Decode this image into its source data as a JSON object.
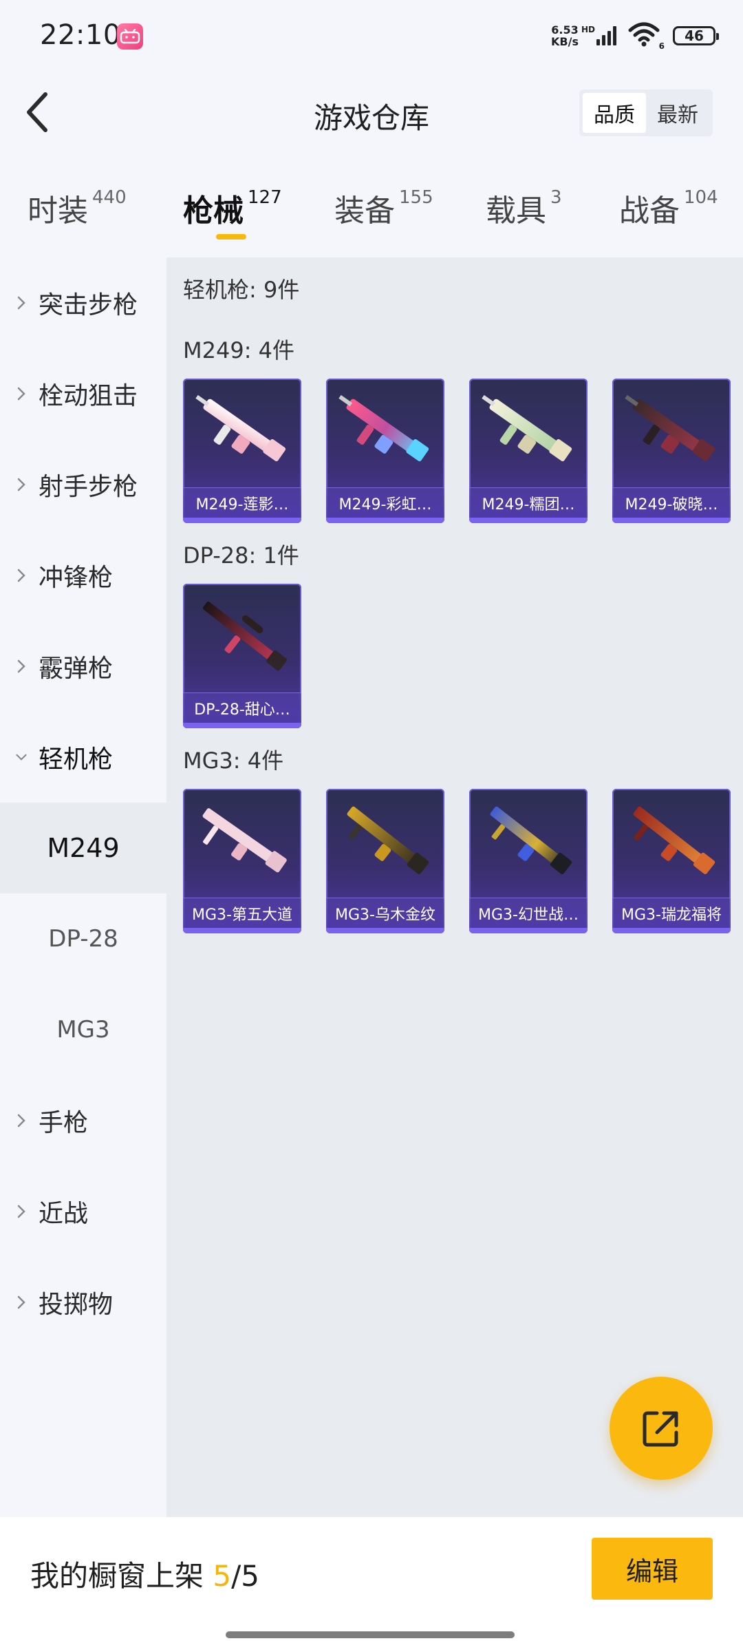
{
  "status_bar": {
    "time": "22:10",
    "net_speed_value": "6.53",
    "net_speed_unit": "KB/s",
    "hd_label": "HD",
    "wifi_label": "6",
    "battery": "46",
    "app_badge": "bilibili"
  },
  "header": {
    "title": "游戏仓库",
    "sort_options": [
      "品质",
      "最新"
    ],
    "sort_active": "品质"
  },
  "tabs": [
    {
      "label": "时装",
      "count": "440"
    },
    {
      "label": "枪械",
      "count": "127",
      "active": true
    },
    {
      "label": "装备",
      "count": "155"
    },
    {
      "label": "载具",
      "count": "3"
    },
    {
      "label": "战备",
      "count": "104"
    }
  ],
  "sidebar": {
    "items": [
      {
        "label": "突击步枪"
      },
      {
        "label": "栓动狙击"
      },
      {
        "label": "射手步枪"
      },
      {
        "label": "冲锋枪"
      },
      {
        "label": "霰弹枪"
      },
      {
        "label": "轻机枪",
        "expanded": true
      },
      {
        "label": "手枪"
      },
      {
        "label": "近战"
      },
      {
        "label": "投掷物"
      }
    ],
    "subitems": [
      {
        "label": "M249",
        "active": true
      },
      {
        "label": "DP-28"
      },
      {
        "label": "MG3"
      }
    ]
  },
  "content": {
    "category_title": "轻机枪: 9件",
    "groups": [
      {
        "title": "M249: 4件",
        "items": [
          {
            "label": "M249-莲影…",
            "art": "rifle-white-pink"
          },
          {
            "label": "M249-彩虹…",
            "art": "rifle-rainbow"
          },
          {
            "label": "M249-糯团…",
            "art": "rifle-cream-green"
          },
          {
            "label": "M249-破晓…",
            "art": "rifle-dark-red"
          }
        ]
      },
      {
        "title": "DP-28: 1件",
        "items": [
          {
            "label": "DP-28-甜心…",
            "art": "rifle-black-pink"
          }
        ]
      },
      {
        "title": "MG3: 4件",
        "items": [
          {
            "label": "MG3-第五大道",
            "art": "rifle-pink"
          },
          {
            "label": "MG3-乌木金纹",
            "art": "rifle-black-gold"
          },
          {
            "label": "MG3-幻世战…",
            "art": "rifle-blue-gold"
          },
          {
            "label": "MG3-瑞龙福将",
            "art": "rifle-red-orange"
          }
        ]
      }
    ]
  },
  "bottom_bar": {
    "label": "我的橱窗上架",
    "current": "5",
    "total": "/5",
    "edit_label": "编辑"
  },
  "colors": {
    "accent": "#fbb80f",
    "card_border": "#6b59d6",
    "card_bg": "#3a2f6e"
  }
}
